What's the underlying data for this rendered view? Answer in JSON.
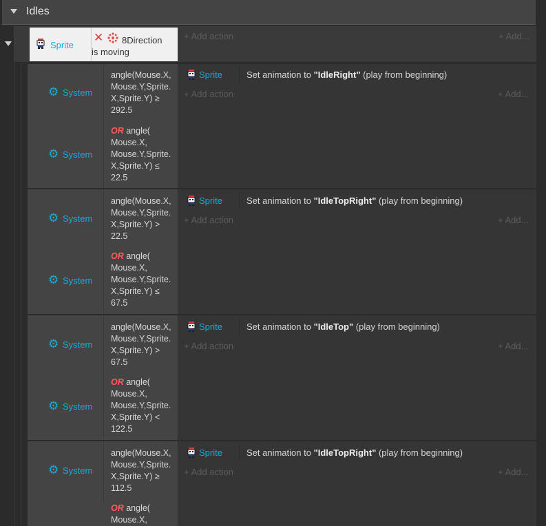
{
  "group": {
    "title": "Idles"
  },
  "parent_event": {
    "condition_object": "Sprite",
    "behavior_name": "8Direction",
    "behavior_state": "is moving",
    "add_action": "Add action",
    "add_more": "Add..."
  },
  "events": [
    {
      "cond1_object": "System",
      "cond1_expr": "angle(Mouse.X, Mouse.Y,Sprite. X,Sprite.Y) ≥ 292.5",
      "cond2_object": "System",
      "cond2_or": "OR",
      "cond2_expr": " angle( Mouse.X, Mouse.Y,Sprite. X,Sprite.Y) ≤ 22.5",
      "action_object": "Sprite",
      "action_prefix": "Set animation to ",
      "action_anim": "\"IdleRight\"",
      "action_suffix": " (play from beginning)",
      "add_action": "Add action",
      "add_more": "Add..."
    },
    {
      "cond1_object": "System",
      "cond1_expr": "angle(Mouse.X, Mouse.Y,Sprite. X,Sprite.Y) > 22.5",
      "cond2_object": "System",
      "cond2_or": "OR",
      "cond2_expr": " angle( Mouse.X, Mouse.Y,Sprite. X,Sprite.Y) ≤ 67.5",
      "action_object": "Sprite",
      "action_prefix": "Set animation to ",
      "action_anim": "\"IdleTopRight\"",
      "action_suffix": " (play from beginning)",
      "add_action": "Add action",
      "add_more": "Add..."
    },
    {
      "cond1_object": "System",
      "cond1_expr": "angle(Mouse.X, Mouse.Y,Sprite. X,Sprite.Y) > 67.5",
      "cond2_object": "System",
      "cond2_or": "OR",
      "cond2_expr": " angle( Mouse.X, Mouse.Y,Sprite. X,Sprite.Y) < 122.5",
      "action_object": "Sprite",
      "action_prefix": "Set animation to ",
      "action_anim": "\"IdleTop\"",
      "action_suffix": " (play from beginning)",
      "add_action": "Add action",
      "add_more": "Add..."
    },
    {
      "cond1_object": "System",
      "cond1_expr": "angle(Mouse.X, Mouse.Y,Sprite. X,Sprite.Y) ≥ 112.5",
      "cond2_object": "System",
      "cond2_or": "OR",
      "cond2_expr": " angle( Mouse.X,",
      "action_object": "Sprite",
      "action_prefix": "Set animation to ",
      "action_anim": "\"IdleTopRight\"",
      "action_suffix": " (play from beginning)",
      "add_action": "Add action",
      "add_more": "Add..."
    }
  ],
  "icons": {
    "group_caret": "caret-down-icon",
    "sprite": "sprite-object-icon",
    "system": "gear-icon",
    "delete": "close-icon",
    "behavior": "8direction-behavior-icon",
    "add": "plus-icon"
  },
  "colors": {
    "object_link": "#1ba9d6",
    "or_keyword": "#ff5b5b",
    "delete_icon": "#e23a3a"
  }
}
